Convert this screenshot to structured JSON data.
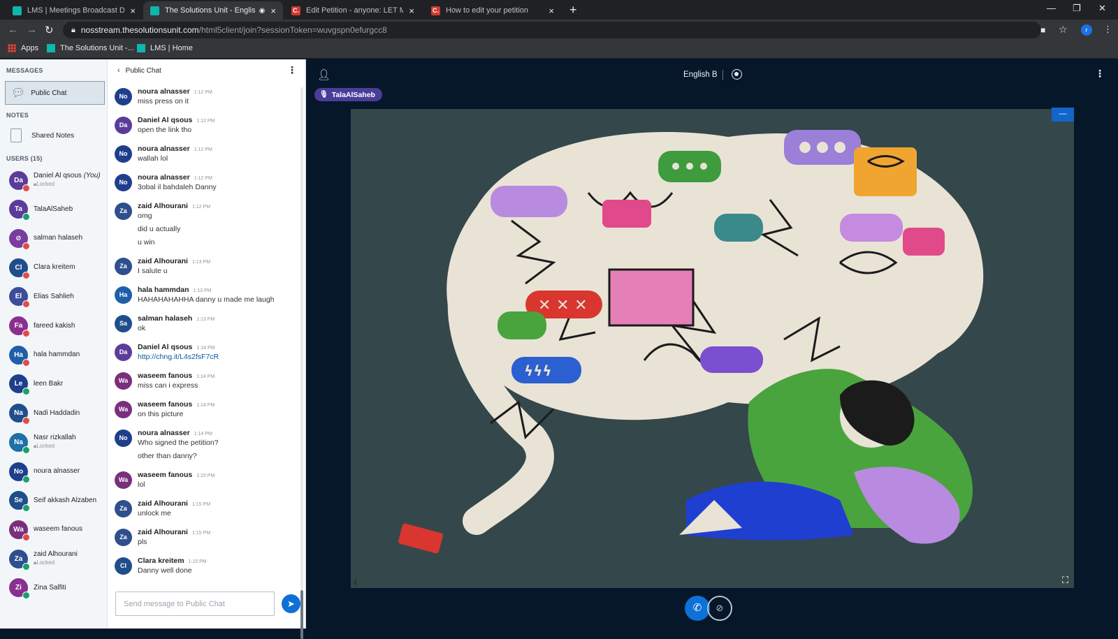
{
  "browser": {
    "tabs": [
      {
        "title": "LMS | Meetings Broadcast Details",
        "favicon": "lms-icon"
      },
      {
        "title": "The Solutions Unit - English B",
        "favicon": "lms-icon"
      },
      {
        "title": "Edit Petition - anyone: LET MISS T",
        "favicon": "change-org-icon"
      },
      {
        "title": "How to edit your petition",
        "favicon": "change-org-icon"
      }
    ],
    "url_host": "nosstream.thesolutionsunit.com",
    "url_path": "/html5client/join?sessionToken=wuvgspn0efurgcc8",
    "profile_initial": "r",
    "bookmarks": [
      {
        "label": "Apps"
      },
      {
        "label": "The Solutions Unit -..."
      },
      {
        "label": "LMS | Home"
      }
    ]
  },
  "sidebar": {
    "messages_title": "MESSAGES",
    "public_chat_label": "Public Chat",
    "notes_title": "NOTES",
    "shared_notes_label": "Shared Notes",
    "users_title": "USERS (15)",
    "users": [
      {
        "initials": "Da",
        "name": "Daniel Al qsous",
        "you_tag": "(You)",
        "locked": "Locked",
        "color": "#5b3c9a",
        "status": "red"
      },
      {
        "initials": "Ta",
        "name": "TalaAlSaheb",
        "you_tag": "",
        "locked": "",
        "color": "#5b3c9a",
        "status": "green"
      },
      {
        "initials": "⊘",
        "name": "salman halaseh",
        "you_tag": "",
        "locked": "",
        "color": "#7a3ca0",
        "status": "red"
      },
      {
        "initials": "Cl",
        "name": "Clara kreitem",
        "you_tag": "",
        "locked": "",
        "color": "#1f4e8c",
        "status": "red"
      },
      {
        "initials": "El",
        "name": "Elias Sahlieh",
        "you_tag": "",
        "locked": "",
        "color": "#3d4d9c",
        "status": "red"
      },
      {
        "initials": "Fa",
        "name": "fareed kakish",
        "you_tag": "",
        "locked": "",
        "color": "#8a2f8f",
        "status": "red"
      },
      {
        "initials": "Ha",
        "name": "hala hammdan",
        "you_tag": "",
        "locked": "",
        "color": "#1f5ea8",
        "status": "red"
      },
      {
        "initials": "Le",
        "name": "leen Bakr",
        "you_tag": "",
        "locked": "",
        "color": "#1f3f8c",
        "status": "green"
      },
      {
        "initials": "Na",
        "name": "Nadi Haddadin",
        "you_tag": "",
        "locked": "",
        "color": "#1f4e8c",
        "status": "red"
      },
      {
        "initials": "Na",
        "name": "Nasr rizkallah",
        "you_tag": "",
        "locked": "Locked",
        "color": "#1f6fa8",
        "status": "green"
      },
      {
        "initials": "No",
        "name": "noura alnasser",
        "you_tag": "",
        "locked": "",
        "color": "#1f3f8c",
        "status": "green"
      },
      {
        "initials": "Se",
        "name": "Seif akkash Alzaben",
        "you_tag": "",
        "locked": "",
        "color": "#1f4e8c",
        "status": "green"
      },
      {
        "initials": "Wa",
        "name": "waseem fanous",
        "you_tag": "",
        "locked": "",
        "color": "#7a2f7c",
        "status": "red"
      },
      {
        "initials": "Za",
        "name": "zaid Alhourani",
        "you_tag": "",
        "locked": "Locked",
        "color": "#2e4f8c",
        "status": "green"
      },
      {
        "initials": "Zi",
        "name": "Zina Salfiti",
        "you_tag": "",
        "locked": "",
        "color": "#8a2f8f",
        "status": "green"
      }
    ]
  },
  "chat": {
    "title": "Public Chat",
    "input_placeholder": "Send message to Public Chat",
    "messages": [
      {
        "initials": "No",
        "color": "#1f3f8c",
        "author": "noura alnasser",
        "time": "1:12 PM",
        "lines": [
          "miss press on it"
        ]
      },
      {
        "initials": "Da",
        "color": "#5b3c9a",
        "author": "Daniel Al qsous",
        "time": "1:12 PM",
        "lines": [
          "open the link tho"
        ]
      },
      {
        "initials": "No",
        "color": "#1f3f8c",
        "author": "noura alnasser",
        "time": "1:12 PM",
        "lines": [
          "wallah lol"
        ]
      },
      {
        "initials": "No",
        "color": "#1f3f8c",
        "author": "noura alnasser",
        "time": "1:12 PM",
        "lines": [
          "3obal il bahdaleh Danny"
        ]
      },
      {
        "initials": "Za",
        "color": "#2e4f8c",
        "author": "zaid Alhourani",
        "time": "1:12 PM",
        "lines": [
          "omg",
          "did u actually",
          "u win"
        ]
      },
      {
        "initials": "Za",
        "color": "#2e4f8c",
        "author": "zaid Alhourani",
        "time": "1:13 PM",
        "lines": [
          "I salute u"
        ]
      },
      {
        "initials": "Ha",
        "color": "#1f5ea8",
        "author": "hala hammdan",
        "time": "1:13 PM",
        "lines": [
          "HAHAHAHAHHA danny u made me laugh"
        ]
      },
      {
        "initials": "Sa",
        "color": "#1f4e8c",
        "author": "salman halaseh",
        "time": "1:13 PM",
        "lines": [
          "ok"
        ]
      },
      {
        "initials": "Da",
        "color": "#5b3c9a",
        "author": "Daniel Al qsous",
        "time": "1:14 PM",
        "lines": [
          "http://chng.it/L4s2fsF7cR"
        ],
        "link": true
      },
      {
        "initials": "Wa",
        "color": "#7a2f7c",
        "author": "waseem fanous",
        "time": "1:14 PM",
        "lines": [
          "miss can i express"
        ]
      },
      {
        "initials": "Wa",
        "color": "#7a2f7c",
        "author": "waseem fanous",
        "time": "1:14 PM",
        "lines": [
          "on this picture"
        ]
      },
      {
        "initials": "No",
        "color": "#1f3f8c",
        "author": "noura alnasser",
        "time": "1:14 PM",
        "lines": [
          "Who signed the petition?",
          "other than danny?"
        ]
      },
      {
        "initials": "Wa",
        "color": "#7a2f7c",
        "author": "waseem fanous",
        "time": "1:15 PM",
        "lines": [
          "lol"
        ]
      },
      {
        "initials": "Za",
        "color": "#2e4f8c",
        "author": "zaid Alhourani",
        "time": "1:15 PM",
        "lines": [
          "unlock me"
        ]
      },
      {
        "initials": "Za",
        "color": "#2e4f8c",
        "author": "zaid Alhourani",
        "time": "1:15 PM",
        "lines": [
          "pls"
        ]
      },
      {
        "initials": "Cl",
        "color": "#1f4e8c",
        "author": "Clara kreitem",
        "time": "1:15 PM",
        "lines": [
          "Danny well done"
        ]
      }
    ]
  },
  "main": {
    "meeting_title": "English B",
    "talking_user": "TalaAlSaheb",
    "slide_image": "illustration-person-overwhelmed-by-speech-bubbles"
  },
  "colors": {
    "accent": "#0f70d7",
    "app_background": "#06172a",
    "talker_badge": "#4a3d9a"
  }
}
